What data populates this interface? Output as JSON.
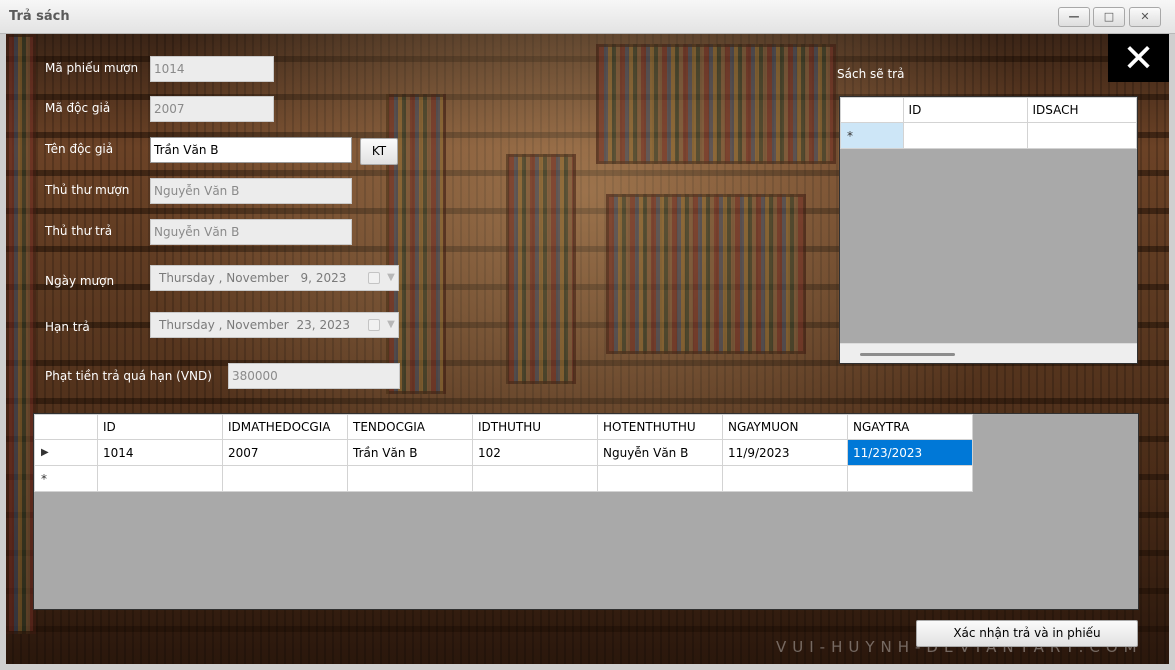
{
  "window": {
    "title": "Trả sách",
    "min_label": "—",
    "max_label": "□",
    "close_label": "✕"
  },
  "form": {
    "ma_phieu_muon": {
      "label": "Mã phiếu mượn",
      "value": "1014"
    },
    "ma_doc_gia": {
      "label": "Mã độc giả",
      "value": "2007"
    },
    "ten_doc_gia": {
      "label": "Tên độc giả",
      "value": "Trần Văn B"
    },
    "kt_button": "KT",
    "thu_thu_muon": {
      "label": "Thủ thư mượn",
      "value": "Nguyễn Văn B"
    },
    "thu_thu_tra": {
      "label": "Thủ thư trả",
      "value": "Nguyễn Văn B"
    },
    "ngay_muon": {
      "label": "Ngày mượn",
      "weekday": "Thursday",
      "month": ", November",
      "day": "9,",
      "year": "2023"
    },
    "han_tra": {
      "label": "Hạn trả",
      "weekday": "Thursday",
      "month": ", November",
      "day": "23,",
      "year": "2023"
    },
    "phat_tien": {
      "label": "Phạt tiền trả quá hạn (VND)",
      "value": "380000"
    },
    "close_icon": "close-icon"
  },
  "books_panel": {
    "label": "Sách sẽ trả",
    "columns": [
      "ID",
      "IDSACH"
    ],
    "new_row_marker": "*"
  },
  "main_grid": {
    "columns": [
      "ID",
      "IDMATHEDOCGIA",
      "TENDOCGIA",
      "IDTHUTHU",
      "HOTENTHUTHU",
      "NGAYMUON",
      "NGAYTRA"
    ],
    "rows": [
      {
        "marker": "▶",
        "cells": [
          "1014",
          "2007",
          "Trần Văn B",
          "102",
          "Nguyễn Văn B",
          "11/9/2023",
          "11/23/2023"
        ]
      }
    ],
    "new_row_marker": "*"
  },
  "confirm_button": "Xác nhận trả và in phiếu",
  "watermark": "VUI-HUYNH-DEVIANTART.COM",
  "colors": {
    "selection": "#0078d7",
    "grid_bg": "#a9a9a9"
  }
}
